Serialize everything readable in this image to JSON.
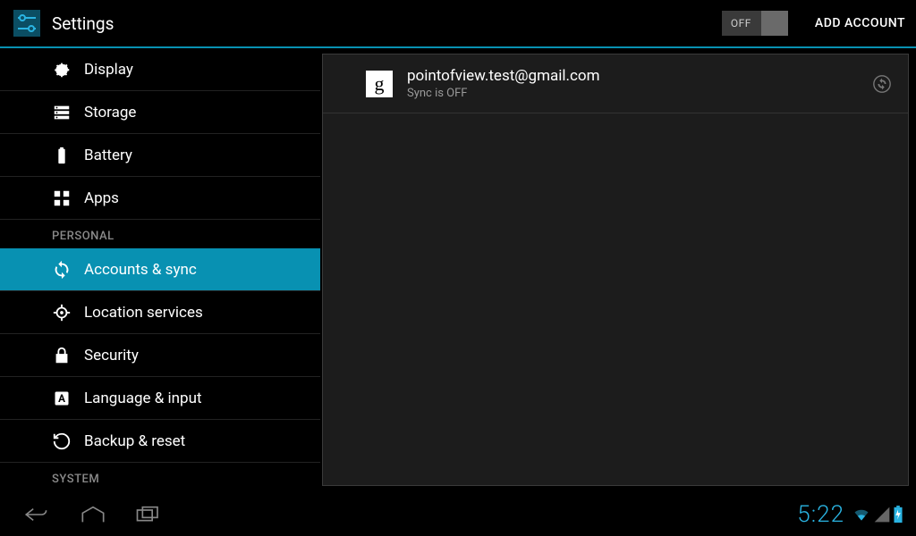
{
  "header": {
    "title": "Settings",
    "toggle_label": "OFF",
    "add_account_label": "ADD ACCOUNT"
  },
  "sidebar": {
    "section_personal": "PERSONAL",
    "section_system": "SYSTEM",
    "items": {
      "display": "Display",
      "storage": "Storage",
      "battery": "Battery",
      "apps": "Apps",
      "accounts": "Accounts & sync",
      "location": "Location services",
      "security": "Security",
      "language": "Language & input",
      "backup": "Backup & reset"
    }
  },
  "account": {
    "email": "pointofview.test@gmail.com",
    "status": "Sync is OFF"
  },
  "statusbar": {
    "time": "5:22"
  }
}
